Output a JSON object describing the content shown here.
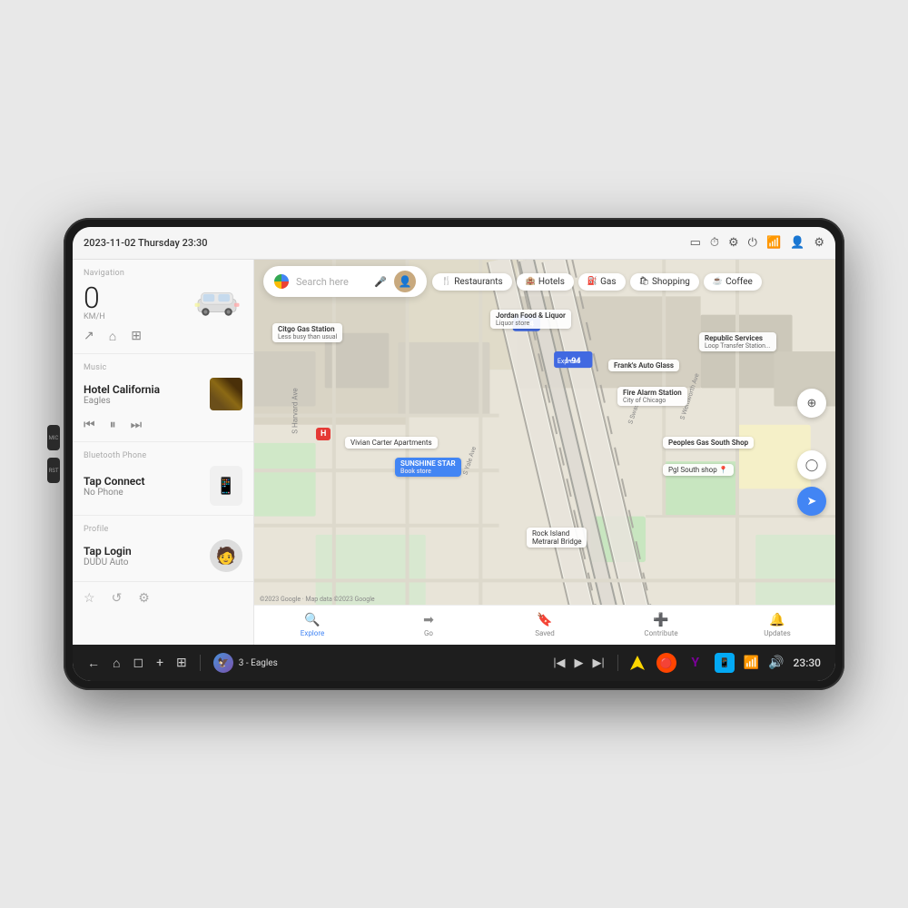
{
  "device": {
    "status_bar": {
      "date_time": "2023-11-02 Thursday 23:30"
    },
    "side_buttons": [
      {
        "label": "MIC"
      },
      {
        "label": "RST"
      }
    ]
  },
  "left_panel": {
    "navigation": {
      "section_label": "Navigation",
      "speed": "0",
      "unit": "KM/H",
      "nav_icons": [
        "↗",
        "⌂",
        "⊞"
      ]
    },
    "music": {
      "section_label": "Music",
      "title": "Hotel California",
      "artist": "Eagles",
      "controls": [
        "⏮",
        "⏸",
        "⏭"
      ]
    },
    "bluetooth": {
      "section_label": "Bluetooth Phone",
      "title": "Tap Connect",
      "subtitle": "No Phone"
    },
    "profile": {
      "section_label": "Profile",
      "title": "Tap Login",
      "subtitle": "DUDU Auto"
    },
    "footer_icons": [
      "☆",
      "↺",
      "⚙"
    ]
  },
  "map": {
    "search_placeholder": "Search here",
    "chips": [
      {
        "icon": "🍴",
        "label": "Restaurants"
      },
      {
        "icon": "🏨",
        "label": "Hotels"
      },
      {
        "icon": "⛽",
        "label": "Gas"
      },
      {
        "icon": "🛍",
        "label": "Shopping"
      },
      {
        "icon": "☕",
        "label": "Coffee"
      }
    ],
    "places": [
      {
        "name": "Citgo Gas Station",
        "sublabel": "Less busy than usual"
      },
      {
        "name": "Jordan Food & Liquor",
        "sublabel": "Liquor store"
      },
      {
        "name": "Frank's Auto Glass"
      },
      {
        "name": "Republic Services Loop Transfer Station"
      },
      {
        "name": "Fire Alarm Station City of Chicago"
      },
      {
        "name": "Vivian Carter Apartments"
      },
      {
        "name": "SUNSHINE STAR",
        "sublabel": "Book store"
      },
      {
        "name": "Peoples Gas South Shop"
      },
      {
        "name": "Pgl South shop"
      },
      {
        "name": "Rock Island Metraral Bridge"
      }
    ],
    "bottom_nav": [
      {
        "icon": "🔍",
        "label": "Explore",
        "active": true
      },
      {
        "icon": "➡",
        "label": "Go"
      },
      {
        "icon": "🔖",
        "label": "Saved"
      },
      {
        "icon": "➕",
        "label": "Contribute"
      },
      {
        "icon": "🔔",
        "label": "Updates"
      }
    ],
    "attribution": "©2023 Google · Map data ©2023 Google"
  },
  "bottom_bar": {
    "nav_icons": [
      "←",
      "⌂",
      "◻"
    ],
    "add_icon": "+",
    "grid_icon": "⊞",
    "track": {
      "number": "3",
      "artist": "Eagles"
    },
    "controls": [
      "|◀",
      "▶",
      "▶|"
    ],
    "app_icons": [
      "🧭",
      "🔴",
      "Y",
      "📱"
    ],
    "wifi": "wifi",
    "volume": "🔊",
    "time": "23:30"
  }
}
